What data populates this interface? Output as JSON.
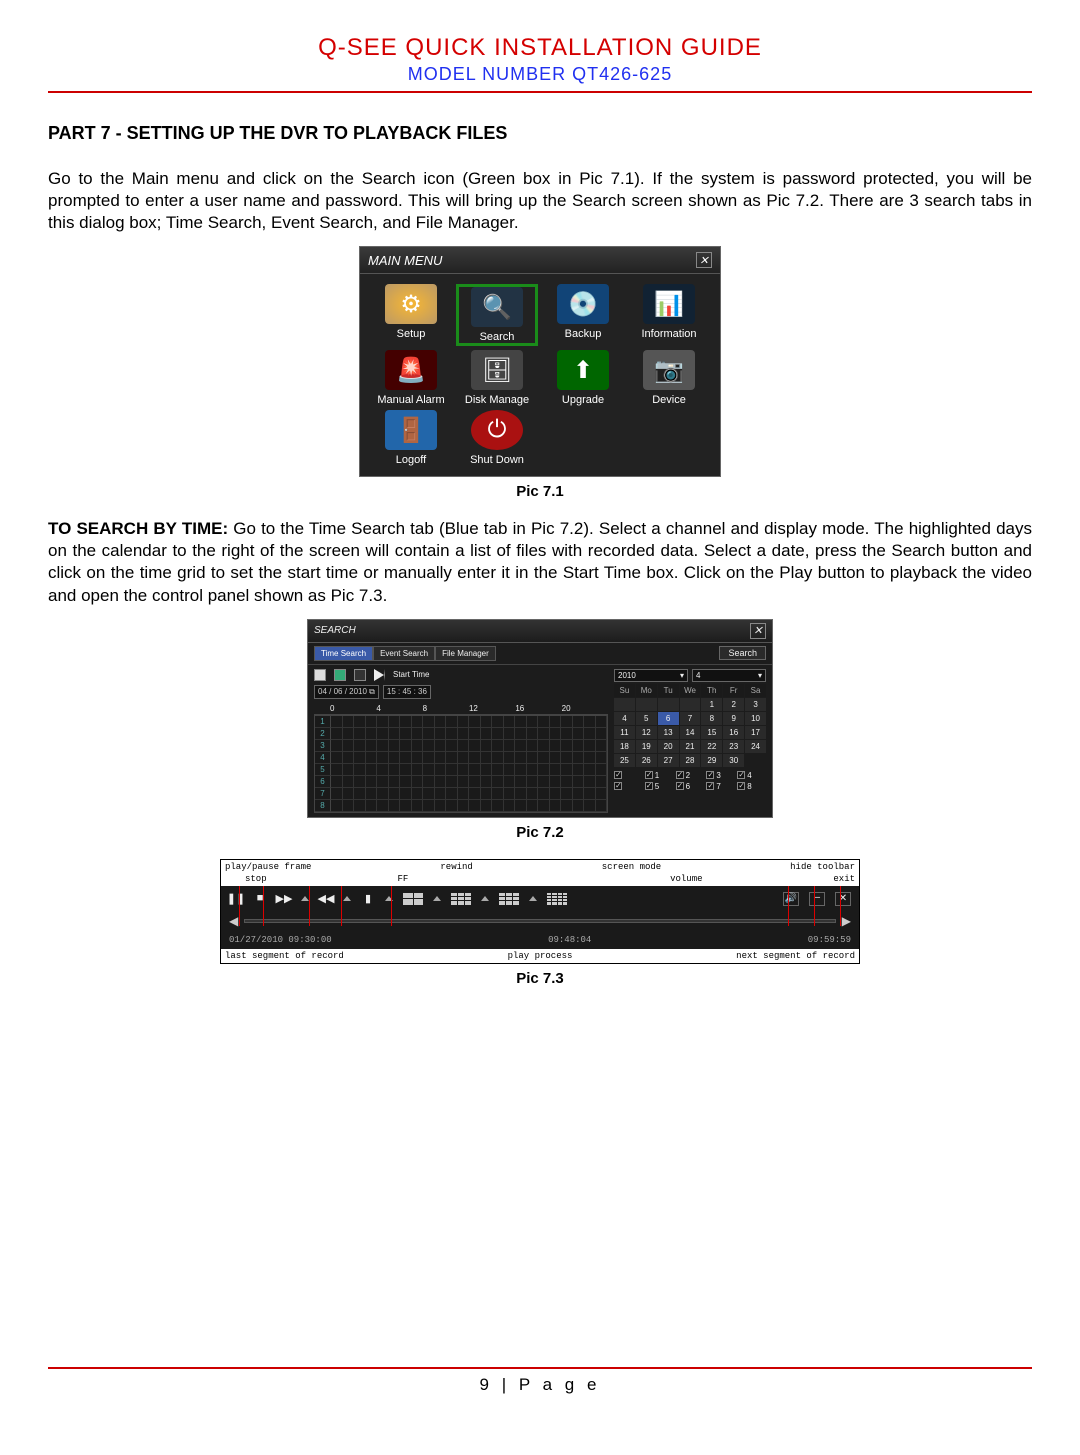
{
  "header": {
    "title": "Q-SEE QUICK INSTALLATION GUIDE",
    "model": "MODEL NUMBER QT426-625"
  },
  "section_title": "PART 7 - SETTING UP THE DVR TO PLAYBACK FILES",
  "para1": "Go to the Main menu and click on the Search icon (Green box in Pic 7.1). If the system is password protected, you will be prompted to enter a user name and password. This will bring up the Search screen shown as Pic 7.2. There are 3 search tabs in this dialog box; Time Search, Event Search, and File Manager.",
  "para2_lead": "TO SEARCH BY TIME:",
  "para2": " Go to the Time Search tab (Blue tab in Pic 7.2). Select a channel and display mode. The highlighted days on the calendar to the right of the screen will contain a list of files with recorded data. Select a date, press the Search button and click on the time grid to set the start time or manually enter it in the Start Time box. Click on the Play button to playback the video and open the control panel shown as Pic 7.3.",
  "captions": {
    "c1": "Pic 7.1",
    "c2": "Pic 7.2",
    "c3": "Pic 7.3"
  },
  "mainmenu": {
    "title": "MAIN  MENU",
    "items": [
      "Setup",
      "Search",
      "Backup",
      "Information",
      "Manual Alarm",
      "Disk Manage",
      "Upgrade",
      "Device",
      "Logoff",
      "Shut Down"
    ]
  },
  "search": {
    "title": "SEARCH",
    "tabs": [
      "Time Search",
      "Event Search",
      "File Manager"
    ],
    "search_btn": "Search",
    "start_label": "Start Time",
    "start_date": "04 / 06 / 2010",
    "start_time": "15 : 45 : 36",
    "hours": [
      "0",
      "4",
      "8",
      "12",
      "16",
      "20"
    ],
    "rows": [
      "1",
      "2",
      "3",
      "4",
      "5",
      "6",
      "7",
      "8"
    ],
    "year": "2010",
    "month": "4",
    "dow": [
      "Su",
      "Mo",
      "Tu",
      "We",
      "Th",
      "Fr",
      "Sa"
    ],
    "days": [
      "",
      "",
      "",
      "",
      "1",
      "2",
      "3",
      "4",
      "5",
      "6",
      "7",
      "8",
      "9",
      "10",
      "11",
      "12",
      "13",
      "14",
      "15",
      "16",
      "17",
      "18",
      "19",
      "20",
      "21",
      "22",
      "23",
      "24",
      "25",
      "26",
      "27",
      "28",
      "29",
      "30"
    ],
    "chk_all": "",
    "chks": [
      "1",
      "2",
      "3",
      "4",
      "5",
      "6",
      "7",
      "8"
    ]
  },
  "playback": {
    "top_labels": [
      "play/pause frame",
      "rewind",
      "screen mode",
      "hide toolbar"
    ],
    "top_labels2": [
      "stop",
      "FF",
      "",
      "volume",
      "exit"
    ],
    "time_start": "01/27/2010 09:30:00",
    "time_cur": "09:48:04",
    "time_end": "09:59:59",
    "bot_labels": [
      "last segment of record",
      "play process",
      "next segment of record"
    ]
  },
  "footer": "9 | P a g e"
}
